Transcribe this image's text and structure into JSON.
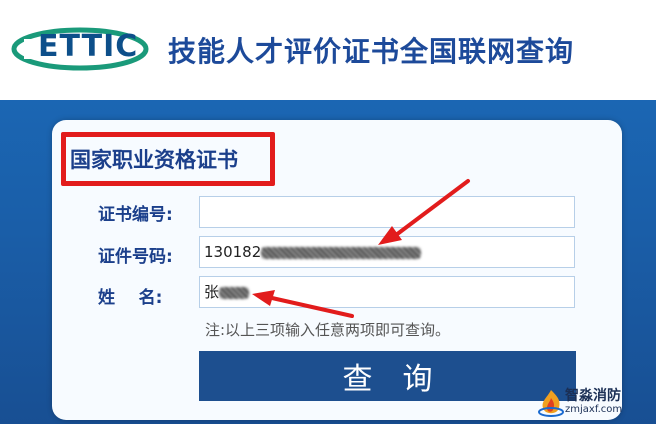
{
  "header": {
    "logo_text": "ETTIC",
    "site_title": "技能人才评价证书全国联网查询"
  },
  "card": {
    "title": "国家职业资格证书",
    "fields": [
      {
        "label": "证书编号:",
        "value": ""
      },
      {
        "label": "证件号码:",
        "value": "130182"
      },
      {
        "label": "姓    名:",
        "value": "张"
      }
    ],
    "note": "注:以上三项输入任意两项即可查询。",
    "query_button": "查询"
  },
  "watermark": {
    "name": "智淼消防",
    "url": "zmjaxf.com"
  },
  "colors": {
    "header_title": "#1d4a9a",
    "background_blue": "#1a5ea8",
    "button": "#1d4f8f",
    "highlight_red": "#e21c1c"
  }
}
